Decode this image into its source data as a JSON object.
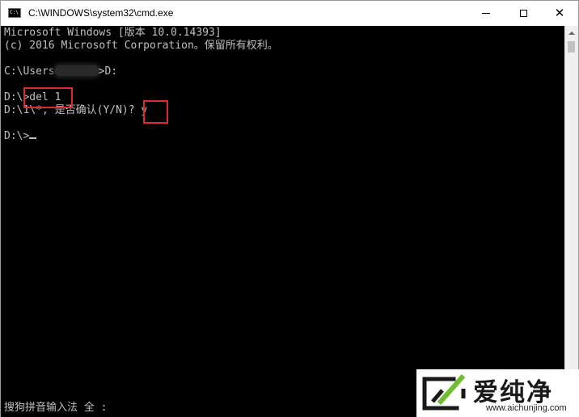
{
  "window": {
    "title": "C:\\WINDOWS\\system32\\cmd.exe",
    "icon_text": "C:\\"
  },
  "controls": {
    "minimize": "minimize",
    "maximize": "maximize",
    "close": "✕"
  },
  "console": {
    "line1": "Microsoft Windows [版本 10.0.14393]",
    "line2": "(c) 2016 Microsoft Corporation。保留所有权利。",
    "line3_prefix": "C:\\Users",
    "line3_suffix": ">D:",
    "line4": "D:\\>del 1",
    "line5_prefix": "D:\\1\\*, 是否确认(Y/N)? ",
    "line5_answer": "y",
    "line6": "D:\\>",
    "ime_status": "搜狗拼音输入法 全 :"
  },
  "highlight_color": "#e0282d",
  "watermark": {
    "title": "爱纯净",
    "url": "www.aichunjing.com"
  }
}
